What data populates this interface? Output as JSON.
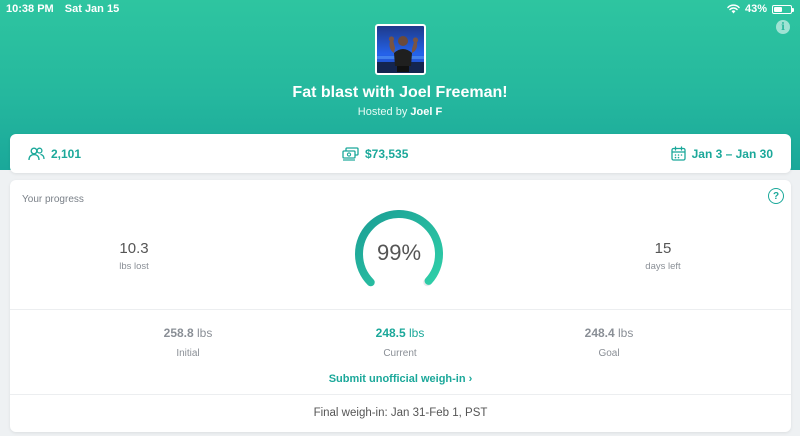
{
  "status_bar": {
    "time": "10:38 PM",
    "date": "Sat Jan 15",
    "battery_pct": "43%",
    "battery_level": 0.43
  },
  "game": {
    "title": "Fat blast with Joel Freeman!",
    "hosted_prefix": "Hosted by",
    "host_name": "Joel F"
  },
  "stats": {
    "players": "2,101",
    "pot": "$73,535",
    "dates": "Jan 3 – Jan 30"
  },
  "progress": {
    "label": "Your progress",
    "lbs_lost_value": "10.3",
    "lbs_lost_label": "lbs lost",
    "percent_text": "99%",
    "percent": 0.99,
    "days_left_value": "15",
    "days_left_label": "days left",
    "initial": {
      "value": "258.8",
      "unit": "lbs",
      "label": "Initial"
    },
    "current": {
      "value": "248.5",
      "unit": "lbs",
      "label": "Current"
    },
    "goal": {
      "value": "248.4",
      "unit": "lbs",
      "label": "Goal"
    },
    "submit_link": "Submit unofficial weigh-in",
    "final_weighin": "Final weigh-in: Jan 31-Feb 1, PST"
  },
  "colors": {
    "accent": "#1ba89a",
    "hero_top": "#2ec5a0",
    "hero_bottom": "#1aa89a"
  },
  "icons": [
    "wifi-icon",
    "battery-icon",
    "info-icon",
    "players-icon",
    "money-icon",
    "calendar-icon",
    "help-icon",
    "chevron-right-icon"
  ]
}
